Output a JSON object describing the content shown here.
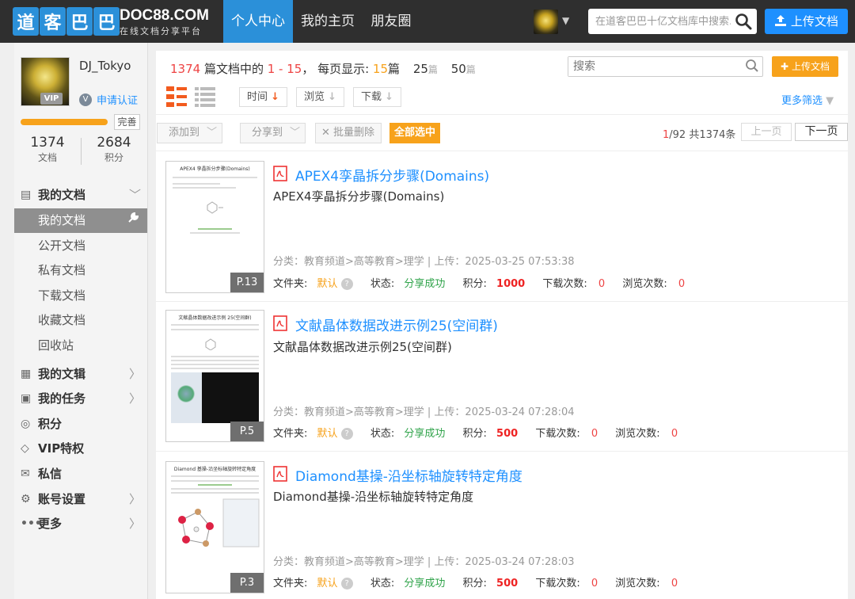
{
  "topbar": {
    "logo_chars": [
      "道",
      "客",
      "巴",
      "巴"
    ],
    "site_name": "DOC88.COM",
    "site_slogan": "在线文档分享平台",
    "nav": [
      "个人中心",
      "我的主页",
      "朋友圈"
    ],
    "search_placeholder": "在道客巴巴十亿文档库中搜索...",
    "upload_label": "上传文档"
  },
  "sidebar": {
    "username": "DJ_Tokyo",
    "vip_label": "VIP",
    "verify_label": "申请认证",
    "complete_label": "完善",
    "stats": {
      "docs_value": "1374",
      "docs_label": "文档",
      "points_value": "2684",
      "points_label": "积分"
    },
    "menu": {
      "my_docs": "我的文档",
      "sub": [
        "我的文档",
        "公开文档",
        "私有文档",
        "下载文档",
        "收藏文档",
        "回收站"
      ],
      "library": "我的文辑",
      "tasks": "我的任务",
      "points": "积分",
      "vip": "VIP特权",
      "messages": "私信",
      "settings": "账号设置",
      "more": "更多"
    }
  },
  "main": {
    "summary": {
      "total": "1374",
      "part1": " 篇文档中的 ",
      "range": "1 - 15",
      "part2": "， 每页显示: ",
      "per_page_current": "15",
      "unit": "篇",
      "opt_25": "25",
      "opt_50": "50"
    },
    "search_placeholder": "搜索",
    "upload_label": "上传文档",
    "sort": [
      "时间",
      "浏览",
      "下载"
    ],
    "more_filter": "更多筛选",
    "actions": {
      "add_to": "添加到",
      "share_to": "分享到",
      "batch_delete": "批量删除",
      "select_all": "全部选中"
    },
    "pagination": {
      "current": "1",
      "rest": "/92 共1374条",
      "prev": "上一页",
      "next": "下一页"
    },
    "labels": {
      "folder": "文件夹:",
      "status": "状态:",
      "points": "积分:",
      "downloads": "下载次数:",
      "views": "浏览次数:"
    },
    "documents": [
      {
        "title": "APEX4孪晶拆分步骤(Domains)",
        "desc": "APEX4孪晶拆分步骤(Domains)",
        "meta": "分类：教育频道>高等教育>理学 | 上传：2025-03-25 07:53:38",
        "folder": "默认",
        "status": "分享成功",
        "points": "1000",
        "downloads": "0",
        "views": "0",
        "pages": "P.13",
        "thumb_title": "APEX4 孪晶拆分步骤(Domains)"
      },
      {
        "title": "文献晶体数据改进示例25(空间群)",
        "desc": "文献晶体数据改进示例25(空间群)",
        "meta": "分类：教育频道>高等教育>理学 | 上传：2025-03-24 07:28:04",
        "folder": "默认",
        "status": "分享成功",
        "points": "500",
        "downloads": "0",
        "views": "0",
        "pages": "P.5",
        "thumb_title": "文献晶体数据改进示例 25(空间群)"
      },
      {
        "title": "Diamond基操-沿坐标轴旋转特定角度",
        "desc": "Diamond基操-沿坐标轴旋转特定角度",
        "meta": "分类：教育频道>高等教育>理学 | 上传：2025-03-24 07:28:03",
        "folder": "默认",
        "status": "分享成功",
        "points": "500",
        "downloads": "0",
        "views": "0",
        "pages": "P.3",
        "thumb_title": "Diamond 基操-沿坐标轴旋转特定角度"
      }
    ]
  }
}
